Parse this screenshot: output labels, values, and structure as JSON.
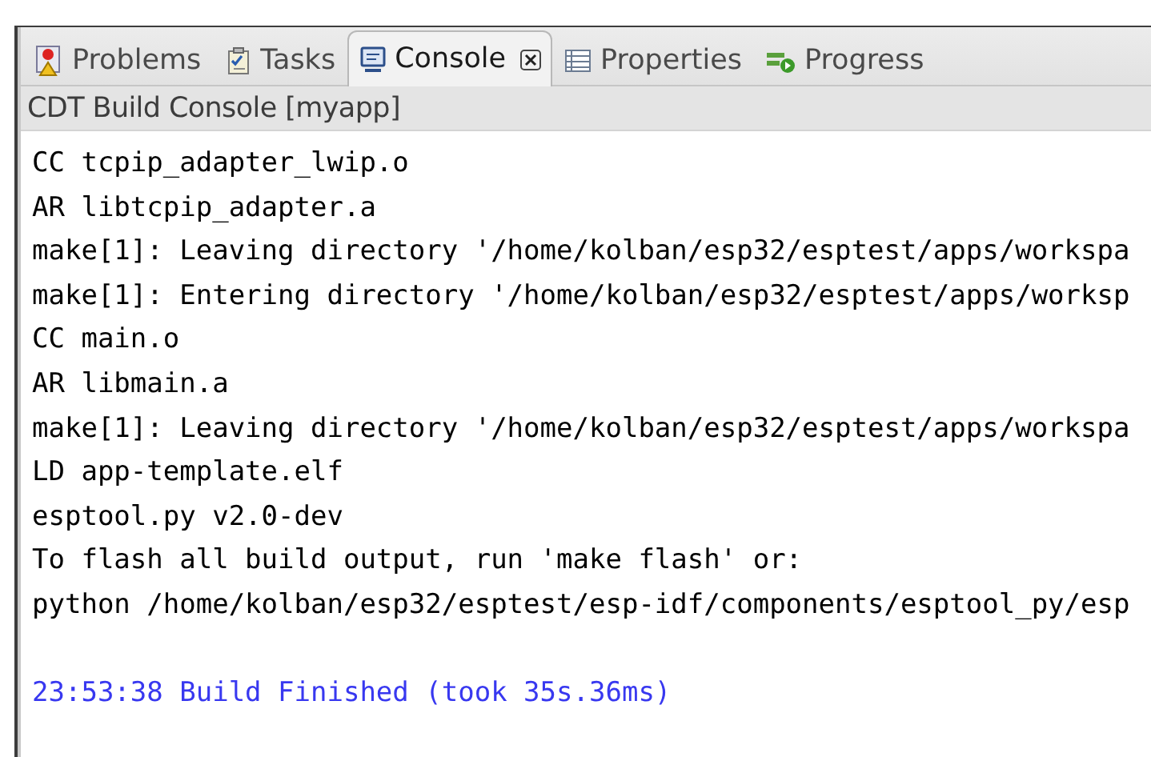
{
  "tabs": [
    {
      "label": "Problems",
      "kind": "problems",
      "selected": false,
      "closable": false
    },
    {
      "label": "Tasks",
      "kind": "tasks",
      "selected": false,
      "closable": false
    },
    {
      "label": "Console",
      "kind": "console",
      "selected": true,
      "closable": true
    },
    {
      "label": "Properties",
      "kind": "properties",
      "selected": false,
      "closable": false
    },
    {
      "label": "Progress",
      "kind": "progress",
      "selected": false,
      "closable": false
    }
  ],
  "console": {
    "title": "CDT Build Console [myapp]",
    "lines": [
      {
        "kind": "output",
        "text": "CC tcpip_adapter_lwip.o"
      },
      {
        "kind": "output",
        "text": "AR libtcpip_adapter.a"
      },
      {
        "kind": "output",
        "text": "make[1]: Leaving directory '/home/kolban/esp32/esptest/apps/workspa"
      },
      {
        "kind": "output",
        "text": "make[1]: Entering directory '/home/kolban/esp32/esptest/apps/worksp"
      },
      {
        "kind": "output",
        "text": "CC main.o"
      },
      {
        "kind": "output",
        "text": "AR libmain.a"
      },
      {
        "kind": "output",
        "text": "make[1]: Leaving directory '/home/kolban/esp32/esptest/apps/workspa"
      },
      {
        "kind": "output",
        "text": "LD app-template.elf"
      },
      {
        "kind": "output",
        "text": "esptool.py v2.0-dev"
      },
      {
        "kind": "output",
        "text": "To flash all build output, run 'make flash' or:"
      },
      {
        "kind": "output",
        "text": "python /home/kolban/esp32/esptest/esp-idf/components/esptool_py/esp"
      },
      {
        "kind": "info",
        "text": "23:53:38 Build Finished (took 35s.36ms)"
      }
    ]
  }
}
